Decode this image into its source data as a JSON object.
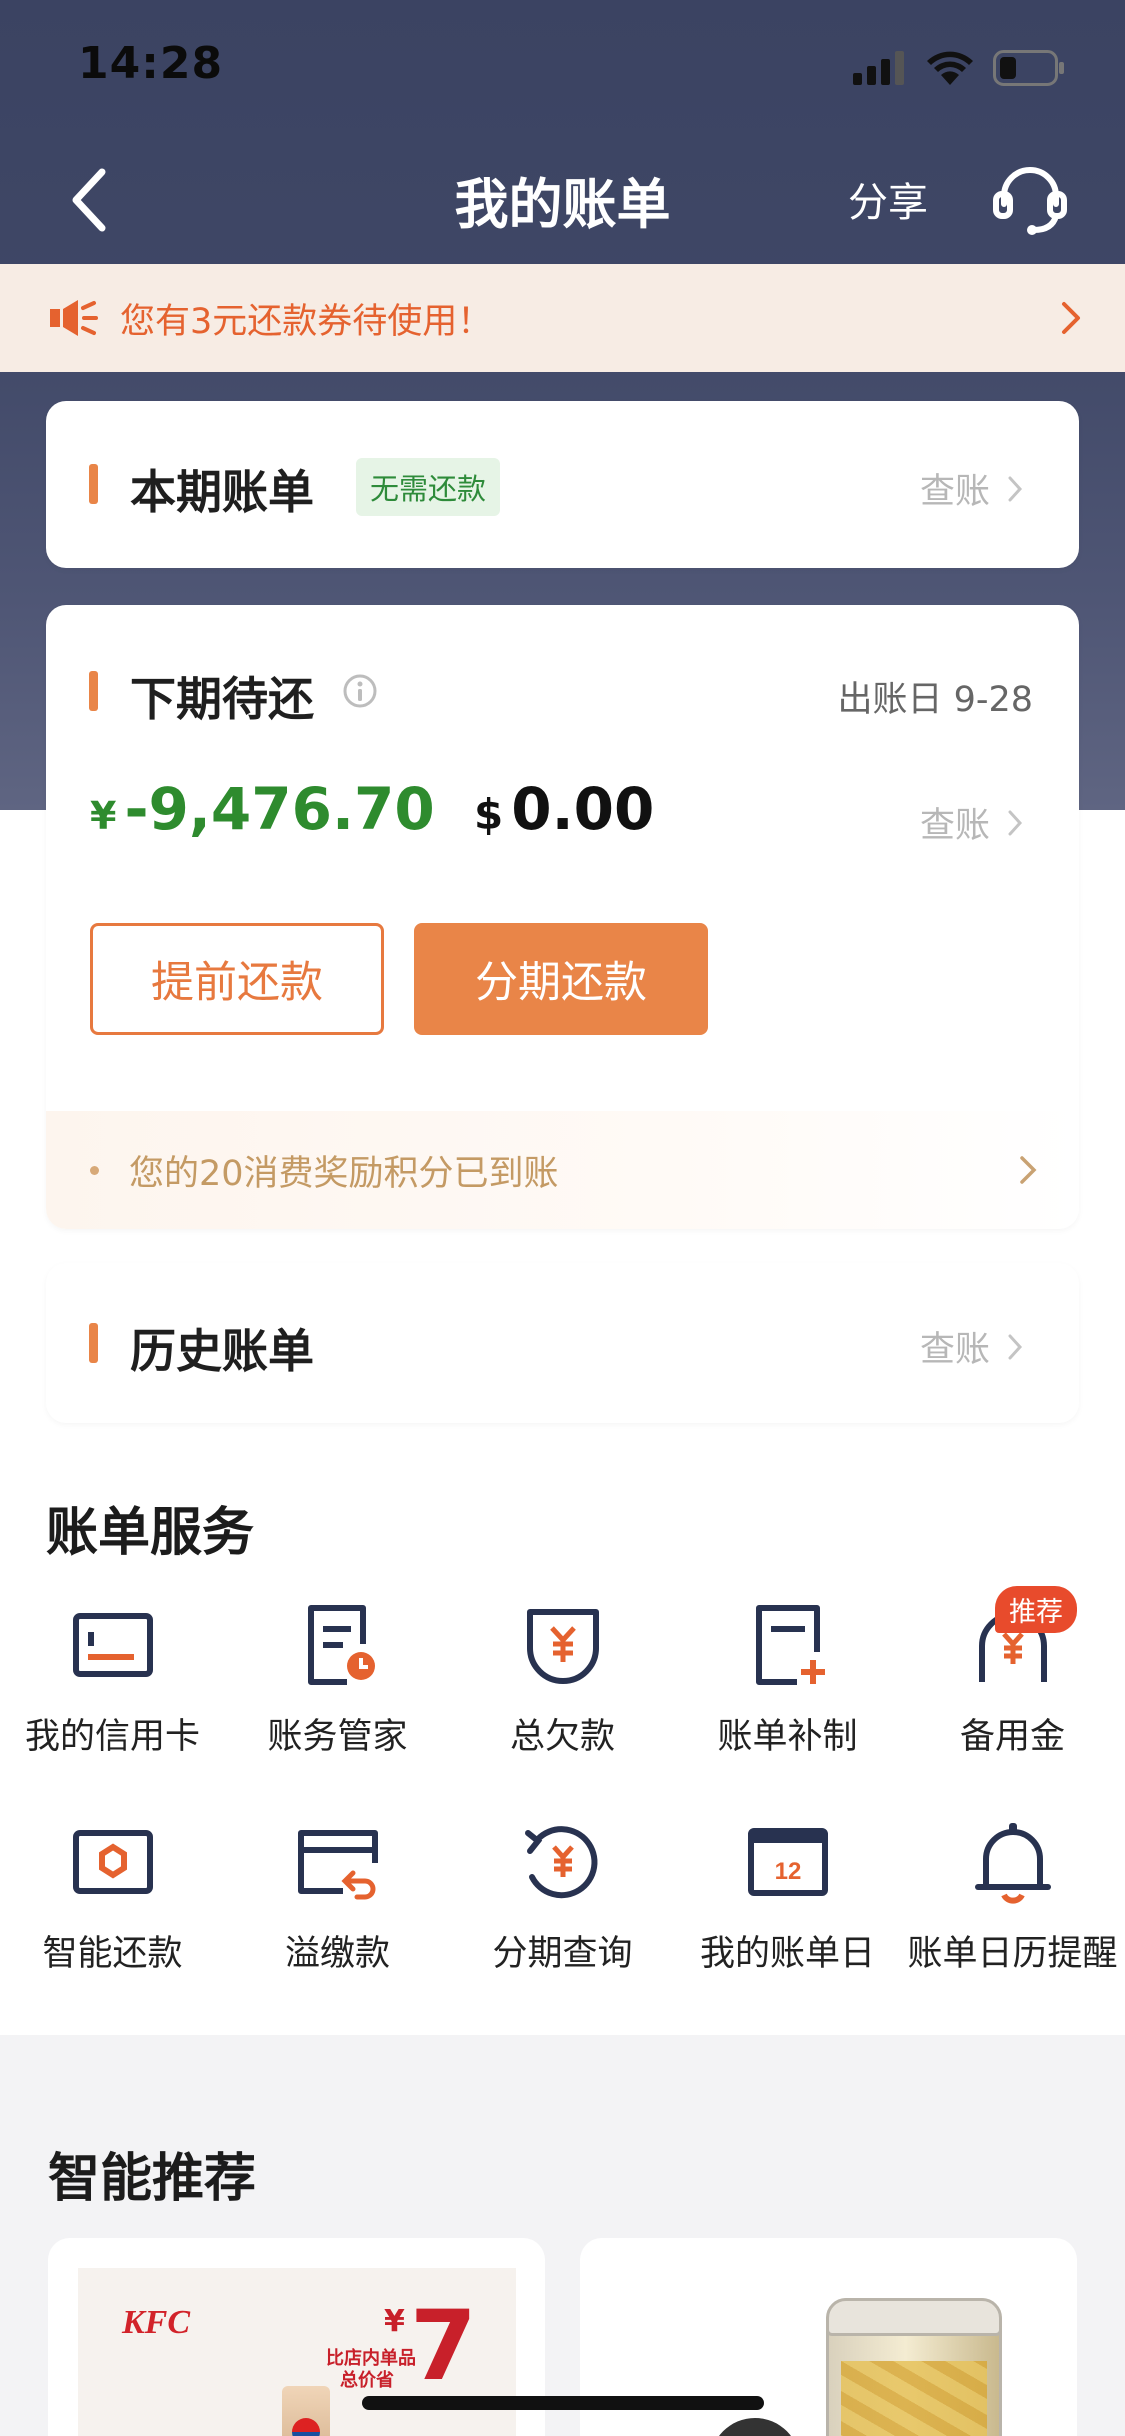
{
  "status_bar": {
    "time": "14:28"
  },
  "nav": {
    "title": "我的账单",
    "share_label": "分享"
  },
  "notice": {
    "text": "您有3元还款券待使用！"
  },
  "current_bill": {
    "title": "本期账单",
    "tag": "无需还款",
    "check_label": "查账"
  },
  "next_due": {
    "title": "下期待还",
    "statement_date_label": "出账日 9-28",
    "cny_symbol": "¥",
    "cny_amount": "-9,476.70",
    "usd_symbol": "$",
    "usd_amount": "0.00",
    "check_label": "查账",
    "prepay_button": "提前还款",
    "installment_button": "分期还款",
    "reward_text": "您的20消费奖励积分已到账"
  },
  "history_bill": {
    "title": "历史账单",
    "check_label": "查账"
  },
  "services": {
    "title": "账单服务",
    "recommend_badge": "推荐",
    "items": [
      {
        "label": "我的信用卡",
        "icon": "credit-card-icon"
      },
      {
        "label": "账务管家",
        "icon": "account-manager-icon"
      },
      {
        "label": "总欠款",
        "icon": "total-debt-icon"
      },
      {
        "label": "账单补制",
        "icon": "bill-reissue-icon"
      },
      {
        "label": "备用金",
        "icon": "reserve-fund-icon"
      },
      {
        "label": "智能还款",
        "icon": "smart-repay-icon"
      },
      {
        "label": "溢缴款",
        "icon": "overpayment-icon"
      },
      {
        "label": "分期查询",
        "icon": "installment-query-icon"
      },
      {
        "label": "我的账单日",
        "icon": "bill-day-icon"
      },
      {
        "label": "账单日历提醒",
        "icon": "bell-icon"
      }
    ]
  },
  "calendar_day": "12",
  "recommend": {
    "title": "智能推荐",
    "kfc_logo": "KFC",
    "kfc_price_symbol": "¥",
    "kfc_price": "7",
    "kfc_caption_1": "比店内单品",
    "kfc_caption_2": "总价省"
  },
  "colors": {
    "accent": "#e98548",
    "green": "#2e8b2e",
    "header": "#3f4766",
    "notice_text": "#e5622f"
  }
}
